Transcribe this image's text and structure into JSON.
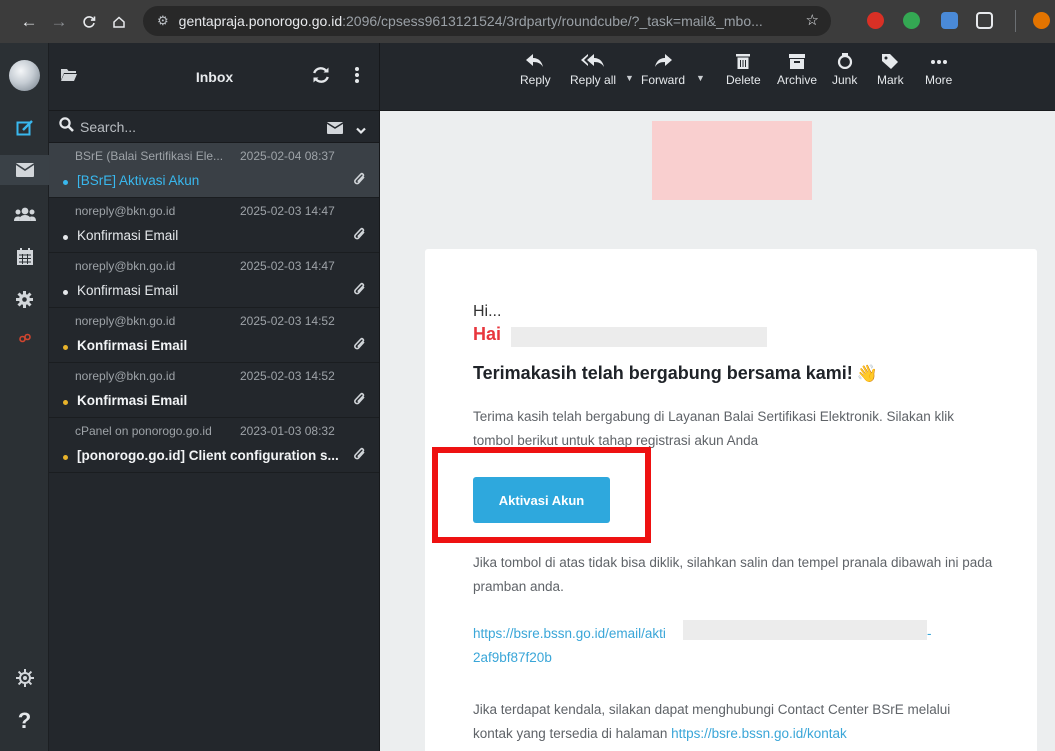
{
  "browser": {
    "url_host": "gentapraja.ponorogo.go.id",
    "url_path": ":2096/cpsess9613121524/3rdparty/roundcube/?_task=mail&_mbo..."
  },
  "listpanel": {
    "folder": "Inbox",
    "search_placeholder": "Search..."
  },
  "messages": [
    {
      "from": "BSrE (Balai Sertifikasi Ele...",
      "date": "2025-02-04 08:37",
      "subject": "[BSrE] Aktivasi Akun"
    },
    {
      "from": "noreply@bkn.go.id",
      "date": "2025-02-03 14:47",
      "subject": "Konfirmasi Email"
    },
    {
      "from": "noreply@bkn.go.id",
      "date": "2025-02-03 14:47",
      "subject": "Konfirmasi Email"
    },
    {
      "from": "noreply@bkn.go.id",
      "date": "2025-02-03 14:52",
      "subject": "Konfirmasi Email"
    },
    {
      "from": "noreply@bkn.go.id",
      "date": "2025-02-03 14:52",
      "subject": "Konfirmasi Email"
    },
    {
      "from": "cPanel on ponorogo.go.id",
      "date": "2023-01-03 08:32",
      "subject": "[ponorogo.go.id] Client configuration s..."
    }
  ],
  "toolbar": {
    "reply": "Reply",
    "reply_all": "Reply all",
    "forward": "Forward",
    "delete": "Delete",
    "archive": "Archive",
    "junk": "Junk",
    "mark": "Mark",
    "more": "More"
  },
  "email": {
    "greeting": "Hi...",
    "hai": "Hai",
    "headline": "Terimakasih telah bergabung bersama kami!",
    "headline_emoji": "👋",
    "intro": "Terima kasih telah bergabung di Layanan Balai Sertifikasi Elektronik. Silakan klik tombol berikut untuk tahap registrasi akun Anda",
    "button": "Aktivasi Akun",
    "fallback": "Jika tombol di atas tidak bisa diklik, silahkan salin dan tempel pranala dibawah ini pada pramban anda.",
    "link_start": "https://bsre.bssn.go.id/email/akti",
    "link_dash": "-",
    "link_end": "2af9bf87f20b",
    "support_text": "Jika terdapat kendala, silakan dapat menghubungi Contact Center BSrE melalui kontak yang tersedia di halaman",
    "support_link": "https://bsre.bssn.go.id/kontak"
  },
  "colors": {
    "accent": "#39b8ee",
    "button": "#2ea8dd",
    "highlight_border": "#ee1111",
    "hai": "#e8363d"
  }
}
